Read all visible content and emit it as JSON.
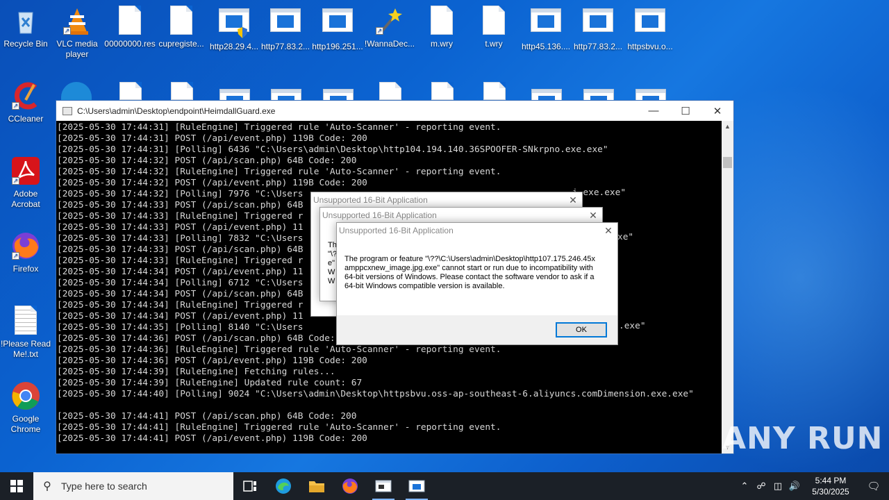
{
  "desktop": {
    "icons_top_row": [
      {
        "label": "Recycle Bin",
        "icon": "recycle-bin-icon"
      },
      {
        "label": "VLC media player",
        "icon": "vlc-icon"
      },
      {
        "label": "00000000.res",
        "icon": "file-icon"
      },
      {
        "label": "cupregiste...",
        "icon": "file-icon"
      },
      {
        "label": "http28.29.4...",
        "icon": "app-shield-icon"
      },
      {
        "label": "http77.83.2...",
        "icon": "app-icon"
      },
      {
        "label": "http196.251...",
        "icon": "app-icon"
      },
      {
        "label": "!WannaDec...",
        "icon": "wand-icon"
      },
      {
        "label": "m.wry",
        "icon": "file-icon"
      },
      {
        "label": "t.wry",
        "icon": "file-icon"
      },
      {
        "label": "http45.136....",
        "icon": "app-icon"
      },
      {
        "label": "http77.83.2...",
        "icon": "app-icon"
      },
      {
        "label": "httpsbvu.o...",
        "icon": "app-icon"
      }
    ],
    "icons_left_col": [
      {
        "label": "CCleaner",
        "icon": "ccleaner-icon"
      },
      {
        "label": "Adobe Acrobat",
        "icon": "acrobat-icon"
      },
      {
        "label": "Firefox",
        "icon": "firefox-icon"
      },
      {
        "label": "!Please Read Me!.txt",
        "icon": "text-file-icon"
      },
      {
        "label": "Google Chrome",
        "icon": "chrome-icon"
      }
    ]
  },
  "console": {
    "title": "C:\\Users\\admin\\Desktop\\endpoint\\HeimdallGuard.exe",
    "lines": [
      "[2025-05-30 17:44:31] [RuleEngine] Triggered rule 'Auto-Scanner' - reporting event.",
      "[2025-05-30 17:44:31] POST (/api/event.php) 119B Code: 200",
      "[2025-05-30 17:44:31] [Polling] 6436 \"C:\\Users\\admin\\Desktop\\http104.194.140.36SPOOFER-SNkrpno.exe.exe\"",
      "[2025-05-30 17:44:32] POST (/api/scan.php) 64B Code: 200",
      "[2025-05-30 17:44:32] [RuleEngine] Triggered rule 'Auto-Scanner' - reporting event.",
      "[2025-05-30 17:44:32] POST (/api/event.php) 119B Code: 200",
      "[2025-05-30 17:44:32] [Polling] 7976 \"C:\\Users",
      "[2025-05-30 17:44:33] POST (/api/scan.php) 64B",
      "[2025-05-30 17:44:33] [RuleEngine] Triggered r",
      "[2025-05-30 17:44:33] POST (/api/event.php) 11",
      "[2025-05-30 17:44:33] [Polling] 7832 \"C:\\Users",
      "[2025-05-30 17:44:33] POST (/api/scan.php) 64B",
      "[2025-05-30 17:44:33] [RuleEngine] Triggered r",
      "[2025-05-30 17:44:34] POST (/api/event.php) 11",
      "[2025-05-30 17:44:34] [Polling] 6712 \"C:\\Users",
      "[2025-05-30 17:44:34] POST (/api/scan.php) 64B",
      "[2025-05-30 17:44:34] [RuleEngine] Triggered r",
      "[2025-05-30 17:44:34] POST (/api/event.php) 11",
      "[2025-05-30 17:44:35] [Polling] 8140 \"C:\\Users",
      "[2025-05-30 17:44:36] POST (/api/scan.php) 64B Code: 200",
      "[2025-05-30 17:44:36] [RuleEngine] Triggered rule 'Auto-Scanner' - reporting event.",
      "[2025-05-30 17:44:36] POST (/api/event.php) 119B Code: 200",
      "[2025-05-30 17:44:39] [RuleEngine] Fetching rules...",
      "[2025-05-30 17:44:39] [RuleEngine] Updated rule count: 67",
      "[2025-05-30 17:44:40] [Polling] 9024 \"C:\\Users\\admin\\Desktop\\httpsbvu.oss-ap-southeast-6.aliyuncs.comDimension.exe.exe\"",
      "",
      "[2025-05-30 17:44:41] POST (/api/scan.php) 64B Code: 200",
      "[2025-05-30 17:44:41] [RuleEngine] Triggered rule 'Auto-Scanner' - reporting event.",
      "[2025-05-30 17:44:41] POST (/api/event.php) 119B Code: 200"
    ],
    "partial_tails": [
      {
        "row": 6,
        "text": "i.exe.exe\""
      },
      {
        "row": 10,
        "text": "xe\""
      },
      {
        "row": 18,
        "text": ".exe\""
      }
    ]
  },
  "dialogs": [
    {
      "title": "Unsupported 16-Bit Application",
      "partial": ""
    },
    {
      "title": "Unsupported 16-Bit Application",
      "partial": "Th\n\"\\?\ne\"\nW\nW"
    },
    {
      "title": "Unsupported 16-Bit Application",
      "message": "The program or feature \"\\??\\C:\\Users\\admin\\Desktop\\http107.175.246.45xamppcxnew_image.jpg.exe\" cannot start or run due to incompatibility with 64-bit versions of Windows. Please contact the software vendor to ask if a 64-bit Windows compatible version is available.",
      "ok_label": "OK"
    }
  ],
  "taskbar": {
    "search_placeholder": "Type here to search",
    "time": "5:44 PM",
    "date": "5/30/2025"
  },
  "watermark": "ANY RUN"
}
